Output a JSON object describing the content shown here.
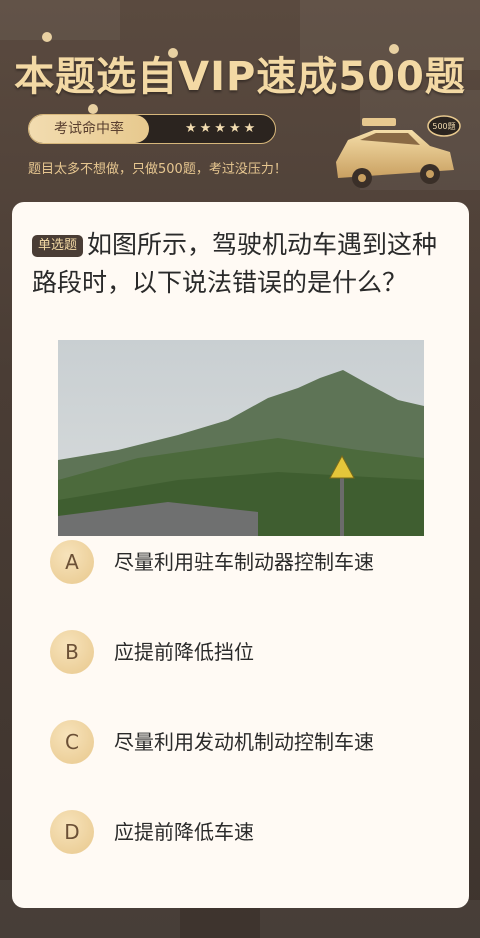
{
  "header": {
    "title": "本题选自VIP速成500题",
    "pill_label": "考试命中率",
    "stars": "★★★★★",
    "tagline": "题目太多不想做，只做500题，考过没压力！",
    "car_badge": "500题"
  },
  "question": {
    "type_badge": "单选题",
    "text": "如图所示，驾驶机动车遇到这种路段时，以下说法错误的是什么？"
  },
  "options": [
    {
      "letter": "A",
      "text": "尽量利用驻车制动器控制车速"
    },
    {
      "letter": "B",
      "text": "应提前降低挡位"
    },
    {
      "letter": "C",
      "text": "尽量利用发动机制动控制车速"
    },
    {
      "letter": "D",
      "text": "应提前降低车速"
    }
  ],
  "colors": {
    "accent": "#f3d9a4",
    "background": "#4a3d35",
    "card": "#fffaf4"
  },
  "icons": [
    "car-icon",
    "star-icon",
    "warning-sign-icon"
  ]
}
